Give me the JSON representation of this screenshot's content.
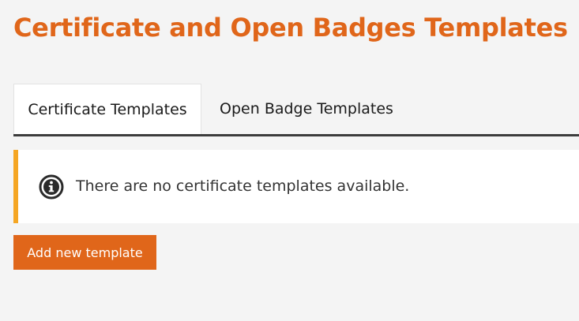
{
  "page": {
    "title": "Certificate and Open Badges Templates"
  },
  "tabs": [
    {
      "label": "Certificate Templates",
      "active": true
    },
    {
      "label": "Open Badge Templates",
      "active": false
    }
  ],
  "alert": {
    "icon": "info-icon",
    "message": "There are no certificate templates available.",
    "accent_color": "#f5a623"
  },
  "actions": {
    "add_label": "Add new template"
  },
  "colors": {
    "brand": "#e0661a",
    "background": "#f4f4f4",
    "tab_underline": "#3c3c3c"
  }
}
